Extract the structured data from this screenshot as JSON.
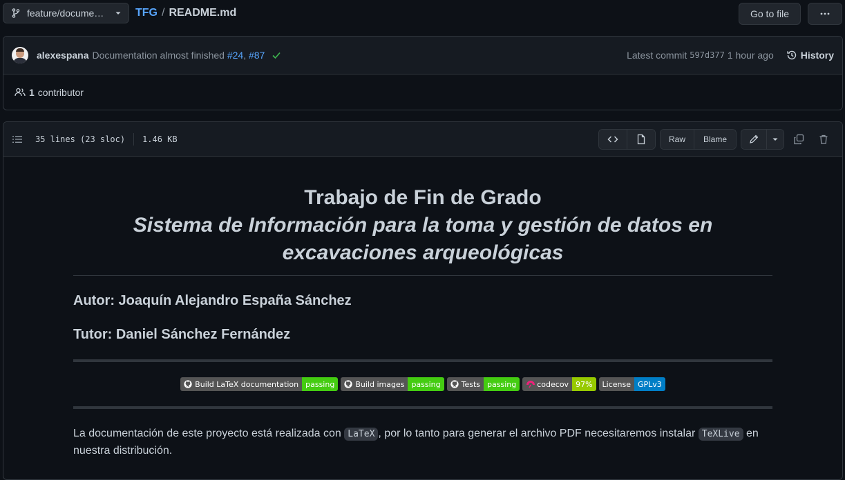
{
  "branch": {
    "label": "feature/docume…"
  },
  "breadcrumb": {
    "repo": "TFG",
    "separator": "/",
    "file": "README.md"
  },
  "buttons": {
    "goto_file": "Go to file"
  },
  "commit": {
    "author": "alexespana",
    "message": "Documentation almost finished",
    "pr1": "#24",
    "pr_sep": ",",
    "pr2": "#87",
    "latest_label": "Latest commit",
    "hash": "597d377",
    "time": "1 hour ago",
    "history_label": "History",
    "status_color": "#3fb950"
  },
  "contributors": {
    "count": "1",
    "label": "contributor"
  },
  "file": {
    "lines": "35 lines (23 sloc)",
    "size": "1.46 KB",
    "raw_label": "Raw",
    "blame_label": "Blame"
  },
  "readme": {
    "title": "Trabajo de Fin de Grado",
    "subtitle": "Sistema de Información para la toma y gestión de datos en excavaciones arqueológicas",
    "author": "Autor: Joaquín Alejandro España Sánchez",
    "tutor": "Tutor: Daniel Sánchez Fernández",
    "badges": [
      {
        "label": "Build LaTeX documentation",
        "value": "passing",
        "color": "#4c1",
        "icon": "github-icon"
      },
      {
        "label": "Build images",
        "value": "passing",
        "color": "#4c1",
        "icon": "github-icon"
      },
      {
        "label": "Tests",
        "value": "passing",
        "color": "#4c1",
        "icon": "github-icon"
      },
      {
        "label": "codecov",
        "value": "97%",
        "color": "#97ca00",
        "icon": "codecov-icon"
      },
      {
        "label": "License",
        "value": "GPLv3",
        "color": "#007ec6",
        "icon": ""
      }
    ],
    "para_1": "La documentación de este proyecto está realizada con",
    "code_1": "LaTeX",
    "para_2": ", por lo tanto para generar el archivo PDF necesitaremos instalar",
    "code_2": "TeXLive",
    "para_3": "en nuestra distribución."
  }
}
